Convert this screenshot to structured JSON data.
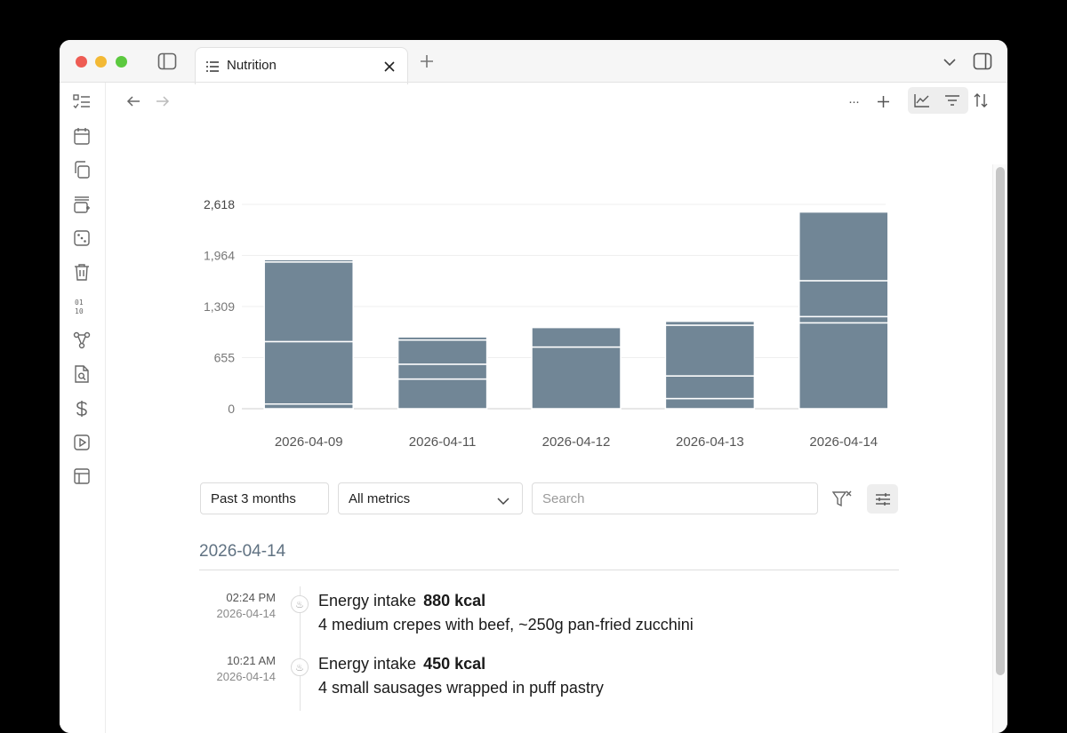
{
  "tab": {
    "title": "Nutrition"
  },
  "rail_icons": [
    "checklist-icon",
    "calendar-icon",
    "copy-icon",
    "stack-add-icon",
    "dice-icon",
    "trash-icon",
    "binary-icon",
    "graph-icon",
    "file-search-icon",
    "dollar-icon",
    "play-icon",
    "layout-icon"
  ],
  "toolbar": {
    "more_label": "···"
  },
  "chart_data": {
    "type": "bar",
    "stacked": true,
    "categories": [
      "2026-04-09",
      "2026-04-11",
      "2026-04-12",
      "2026-04-13",
      "2026-04-14"
    ],
    "y_ticks": [
      "0",
      "655",
      "1,309",
      "1,964",
      "2,618"
    ],
    "ylim": [
      0,
      2618
    ],
    "segments": [
      [
        60,
        380,
        790,
        130,
        1100
      ],
      [
        800,
        190,
        250,
        290,
        80
      ],
      [
        1020,
        310,
        0,
        650,
        0
      ],
      [
        30,
        40,
        0,
        50,
        460
      ],
      [
        0,
        0,
        0,
        0,
        880
      ]
    ],
    "bar_color": "#718696",
    "grid": true
  },
  "filters": {
    "range": "Past 3 months",
    "metric": "All metrics",
    "search_placeholder": "Search"
  },
  "day": {
    "title": "2026-04-14",
    "entries": [
      {
        "time": "02:24 PM",
        "date": "2026-04-14",
        "metric": "Energy intake",
        "value": "880 kcal",
        "desc": "4 medium crepes with beef, ~250g pan-fried zucchini"
      },
      {
        "time": "10:21 AM",
        "date": "2026-04-14",
        "metric": "Energy intake",
        "value": "450 kcal",
        "desc": "4 small sausages wrapped in puff pastry"
      }
    ]
  }
}
